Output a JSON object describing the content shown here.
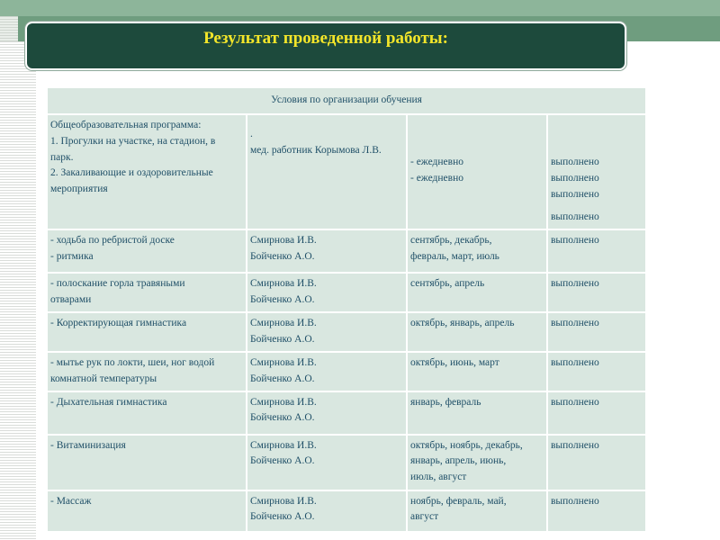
{
  "slide": {
    "title": "Результат проведенной работы:"
  },
  "table": {
    "header": "Условия по организации обучения",
    "first_row": {
      "program_lines": [
        "Общеобразовательная программа:",
        "1. Прогулки на участке, на стадион, в",
        "парк.",
        "2. Закаливающие и оздоровительные",
        "мероприятия"
      ],
      "dot": ".",
      "responsible": "мед. работник Корымова Л.В.",
      "periods": [
        "- ежедневно",
        "- ежедневно"
      ],
      "status": [
        "выполнено",
        "выполнено",
        "выполнено",
        "выполнено"
      ]
    },
    "rows": [
      {
        "activity": [
          "- ходьба по ребристой доске",
          "- ритмика"
        ],
        "responsible": [
          "Смирнова И.В.",
          "Бойченко А.О."
        ],
        "period": [
          "сентябрь, декабрь,",
          "февраль, март, июль"
        ],
        "status": "выполнено"
      },
      {
        "activity": [
          "- полоскание горла травяными",
          "отварами"
        ],
        "responsible": [
          "Смирнова И.В.",
          "Бойченко А.О."
        ],
        "period": [
          "сентябрь, апрель"
        ],
        "status": "выполнено"
      },
      {
        "activity": [
          "- Корректирующая гимнастика"
        ],
        "responsible": [
          "Смирнова И.В.",
          "Бойченко А.О."
        ],
        "period": [
          "октябрь, январь, апрель"
        ],
        "status": "выполнено"
      },
      {
        "activity": [
          "- мытье рук по локти, шеи, ног водой",
          "комнатной температуры"
        ],
        "responsible": [
          "Смирнова И.В.",
          "Бойченко А.О."
        ],
        "period": [
          "октябрь, июнь, март"
        ],
        "status": "выполнено"
      },
      {
        "activity": [
          "- Дыхательная гимнастика"
        ],
        "responsible": [
          "Смирнова И.В.",
          "Бойченко А.О."
        ],
        "period": [
          "январь, февраль"
        ],
        "status": "выполнено"
      },
      {
        "activity": [
          "- Витаминизация"
        ],
        "responsible": [
          "Смирнова И.В.",
          "Бойченко А.О."
        ],
        "period": [
          "октябрь, ноябрь, декабрь,",
          "январь, апрель, июнь,",
          "июль, август"
        ],
        "status": "выполнено"
      },
      {
        "activity": [
          "- Массаж"
        ],
        "responsible": [
          "Смирнова И.В.",
          "Бойченко А.О."
        ],
        "period": [
          "ноябрь, февраль, май,",
          "август"
        ],
        "status": "выполнено"
      }
    ]
  }
}
